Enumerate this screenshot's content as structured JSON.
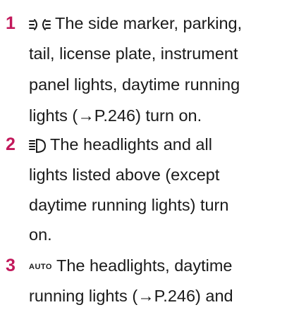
{
  "colors": {
    "number": "#c2185b",
    "text": "#1a1a1a"
  },
  "items": [
    {
      "number": "1",
      "icon": "side-marker-lights-icon",
      "lines": [
        "The side marker, parking,",
        "tail, license plate, instrument",
        "panel lights, daytime running",
        "lights (→P.246) turn on."
      ]
    },
    {
      "number": "2",
      "icon": "headlights-icon",
      "lines": [
        "The headlights and all",
        "lights listed above (except",
        "daytime running lights) turn",
        "on."
      ]
    },
    {
      "number": "3",
      "icon": "auto-icon",
      "icon_label": "AUTO",
      "lines": [
        "The headlights, daytime",
        "running lights (→P.246) and"
      ]
    }
  ]
}
